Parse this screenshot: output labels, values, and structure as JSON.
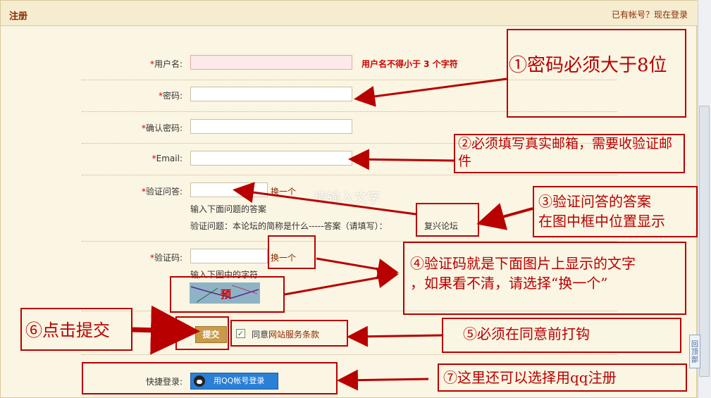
{
  "header": {
    "title": "注册",
    "login_link": "已有帐号？现在登录"
  },
  "form": {
    "required_mark": "*",
    "username_label": "用户名:",
    "username_warning": "用户名不得小于 3 个字符",
    "password_label": "密码:",
    "confirm_label": "确认密码:",
    "email_label": "Email:",
    "question_label": "验证问答:",
    "question_change": "换一个",
    "question_hint": "输入下面问题的答案",
    "question_text": "验证问题：本论坛的简称是什么-----答案（请填写）：",
    "question_answer": "复兴论坛",
    "captcha_label": "验证码:",
    "captcha_change": "换一个",
    "captcha_hint": "输入下图中的字符",
    "captcha_text": "预",
    "submit_label": "提交",
    "agree_prefix": "同意",
    "agree_link": "网站服务条款",
    "quick_login_label": "快捷登录:",
    "qq_button": "用QQ帐号登录",
    "overlay_hint": "请输入文字"
  },
  "annotations": {
    "n1": "①密码必须大于8位",
    "n2": "②必须填写真实邮箱，需要收验证邮件",
    "n3a": "③验证问答的答案",
    "n3b": "在图中框中位置显示",
    "n4a": "④验证码就是下面图片上显示的文字",
    "n4b": "，如果看不清，请选择“换一个”",
    "n5": "⑤必须在同意前打钩",
    "n6": "⑥点击提交",
    "n7": "⑦这里还可以选择用qq注册"
  },
  "scrollbar": {
    "back_to_top": "回顶部"
  },
  "colors": {
    "annotation_red": "#b80000",
    "accent_brown": "#8a2a00",
    "background": "#fbf5e3"
  }
}
